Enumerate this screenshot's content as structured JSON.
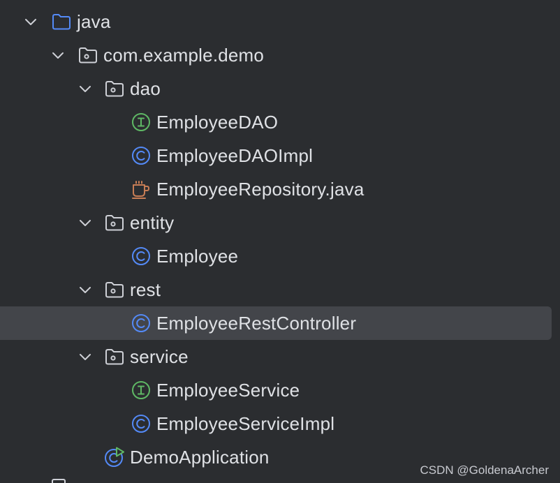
{
  "tree": {
    "rows": [
      {
        "label": "java",
        "kind": "source-folder",
        "icon": "folder-icon",
        "expanded": true
      },
      {
        "label": "com.example.demo",
        "kind": "package",
        "icon": "package-icon",
        "expanded": true
      },
      {
        "label": "dao",
        "kind": "package",
        "icon": "package-icon",
        "expanded": true
      },
      {
        "label": "EmployeeDAO",
        "kind": "interface",
        "icon": "interface-icon"
      },
      {
        "label": "EmployeeDAOImpl",
        "kind": "class",
        "icon": "class-icon"
      },
      {
        "label": "EmployeeRepository.java",
        "kind": "java-file",
        "icon": "java-file-icon"
      },
      {
        "label": "entity",
        "kind": "package",
        "icon": "package-icon",
        "expanded": true
      },
      {
        "label": "Employee",
        "kind": "class",
        "icon": "class-icon"
      },
      {
        "label": "rest",
        "kind": "package",
        "icon": "package-icon",
        "expanded": true
      },
      {
        "label": "EmployeeRestController",
        "kind": "class",
        "icon": "class-icon",
        "selected": true
      },
      {
        "label": "service",
        "kind": "package",
        "icon": "package-icon",
        "expanded": true
      },
      {
        "label": "EmployeeService",
        "kind": "interface",
        "icon": "interface-icon"
      },
      {
        "label": "EmployeeServiceImpl",
        "kind": "class",
        "icon": "class-icon"
      },
      {
        "label": "DemoApplication",
        "kind": "spring-app-class",
        "icon": "spring-boot-run-icon"
      }
    ]
  },
  "watermark": "CSDN @GoldenaArcher",
  "colors": {
    "background": "#2b2d30",
    "selection": "#43454a",
    "text": "#dfe1e5",
    "folder_blue": "#548af7",
    "class_blue": "#548af7",
    "interface_green": "#5fb865",
    "java_file_orange": "#c77d55",
    "neutral_icon": "#ced0d6"
  }
}
